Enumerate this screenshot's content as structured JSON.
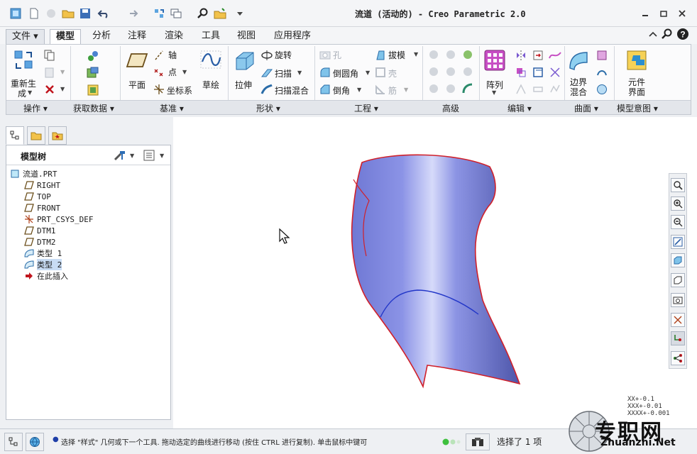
{
  "window": {
    "title": "流道 (活动的) - Creo Parametric 2.0",
    "controls": [
      "minimize",
      "restore",
      "close"
    ]
  },
  "quick_access": {
    "icons": [
      "part-icon",
      "new-icon",
      "disabled-icon",
      "open-icon",
      "save-icon",
      "undo-icon",
      "redo-icon",
      "regenerate-icon",
      "windows-icon",
      "find-icon",
      "folder-icon",
      "customize-icon"
    ]
  },
  "ribbon": {
    "tabs": [
      {
        "label": "文件",
        "caret": "▾"
      },
      {
        "label": "模型"
      },
      {
        "label": "分析"
      },
      {
        "label": "注释"
      },
      {
        "label": "渲染"
      },
      {
        "label": "工具"
      },
      {
        "label": "视图"
      },
      {
        "label": "应用程序"
      }
    ],
    "active_tab": "模型",
    "groups": [
      {
        "label": "操作"
      },
      {
        "label": "获取数据"
      },
      {
        "label": "基准"
      },
      {
        "label": "形状"
      },
      {
        "label": "工程"
      },
      {
        "label": "高级"
      },
      {
        "label": "编辑"
      },
      {
        "label": "曲面"
      },
      {
        "label": "模型意图"
      }
    ],
    "operations": {
      "regenerate_line1": "重新生",
      "regenerate_line2": "成"
    },
    "datum": {
      "plane": "平面",
      "axis": "轴",
      "point": "点",
      "csys": "坐标系",
      "sketch": "草绘"
    },
    "shapes": {
      "extrude": "拉伸",
      "revolve": "旋转",
      "sweep": "扫描",
      "swept_blend": "扫描混合"
    },
    "engineering": {
      "hole": "孔",
      "draft": "拔模",
      "round": "倒圆角",
      "shell": "壳",
      "chamfer": "倒角",
      "rib": "筋"
    },
    "editing": {
      "pattern": "阵列"
    },
    "surfaces": {
      "boundary_line1": "边界",
      "boundary_line2": "混合"
    },
    "model_intent": {
      "component_line1": "元件",
      "component_line2": "界面"
    }
  },
  "model_tree": {
    "title": "模型树",
    "items": [
      {
        "label": "流道.PRT",
        "icon": "part-icon",
        "indent": 0
      },
      {
        "label": "RIGHT",
        "icon": "datum-plane-icon",
        "indent": 1
      },
      {
        "label": "TOP",
        "icon": "datum-plane-icon",
        "indent": 1
      },
      {
        "label": "FRONT",
        "icon": "datum-plane-icon",
        "indent": 1
      },
      {
        "label": "PRT_CSYS_DEF",
        "icon": "csys-icon",
        "indent": 1
      },
      {
        "label": "DTM1",
        "icon": "datum-plane-icon",
        "indent": 1
      },
      {
        "label": "DTM2",
        "icon": "datum-plane-icon",
        "indent": 1
      },
      {
        "label": "类型 1",
        "icon": "surface-icon",
        "indent": 1
      },
      {
        "label": "类型 2",
        "icon": "surface-icon",
        "indent": 1,
        "selected": true
      },
      {
        "label": "在此插入",
        "icon": "insert-arrow-icon",
        "indent": 1
      }
    ]
  },
  "view_toolbar": {
    "buttons": [
      "refit-icon",
      "zoom-in-icon",
      "zoom-out-icon",
      "repaint-icon",
      "display-style-icon",
      "saved-views-icon",
      "view-manager-icon",
      "datum-display-icon",
      "spin-center-icon",
      "annotation-icon"
    ]
  },
  "coordinates": [
    "XX+-0.1",
    "XXX+-0.01",
    "XXXX+-0.001"
  ],
  "status": {
    "message": "选择 \"样式\" 几何或下一个工具. 拖动选定的曲线进行移动 (按住 CTRL 进行复制). 单击鼠标中键可",
    "selection": "选择了 1 项"
  },
  "watermark": {
    "text": "专职网",
    "url": "Zhuanzhi.Net"
  },
  "colors": {
    "surface": "#8b93e6",
    "edge": "#d0202a",
    "blend_curve": "#2236c8",
    "selection": "#c8dcf4"
  }
}
